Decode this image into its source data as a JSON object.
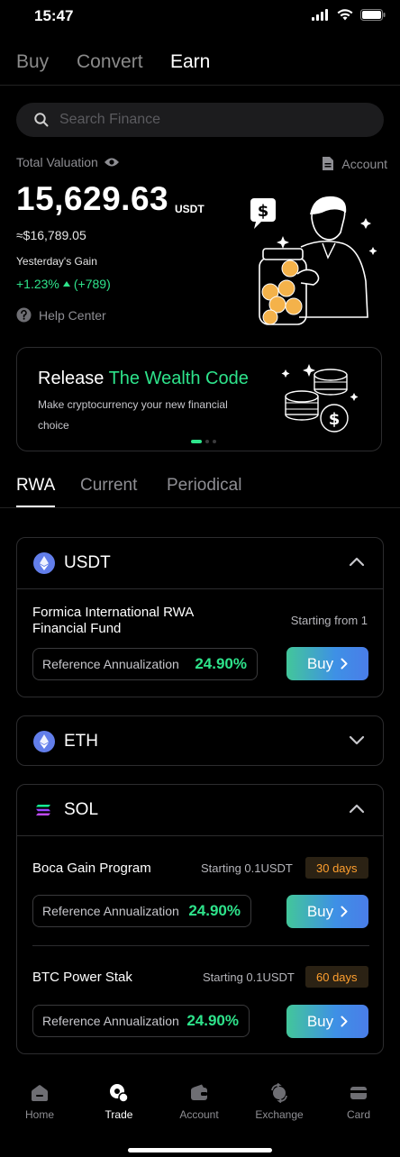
{
  "status": {
    "time": "15:47"
  },
  "top_tabs": [
    {
      "label": "Buy"
    },
    {
      "label": "Convert"
    },
    {
      "label": "Earn"
    }
  ],
  "search": {
    "placeholder": "Search Finance"
  },
  "valuation": {
    "label": "Total Valuation",
    "account_label": "Account",
    "amount": "15,629.63",
    "unit": "USDT",
    "usd": "≈$16,789.05",
    "yesterday_label": "Yesterday's Gain",
    "gain": "+1.23%",
    "gain_abs": "(+789)"
  },
  "help": {
    "label": "Help Center"
  },
  "banner": {
    "title_plain": "Release ",
    "title_highlight": "The Wealth Code",
    "subtitle": "Make cryptocurrency your new financial choice"
  },
  "sub_tabs": [
    {
      "label": "RWA"
    },
    {
      "label": "Current"
    },
    {
      "label": "Periodical"
    }
  ],
  "groups": {
    "usdt": {
      "name": "USDT",
      "product": {
        "title": "Formica International RWA Financial Fund",
        "starting": "Starting from 1",
        "ref_label": "Reference Annualization",
        "rate": "24.90%",
        "buy": "Buy"
      }
    },
    "eth": {
      "name": "ETH"
    },
    "sol": {
      "name": "SOL",
      "products": [
        {
          "title": "Boca Gain Program",
          "starting": "Starting  0.1USDT",
          "days": "30 days",
          "ref_label": "Reference Annualization",
          "rate": "24.90%",
          "buy": "Buy"
        },
        {
          "title": "BTC Power Stak",
          "starting": "Starting  0.1USDT",
          "days": "60 days",
          "ref_label": "Reference Annualization",
          "rate": "24.90%",
          "buy": "Buy"
        }
      ]
    }
  },
  "nav": [
    {
      "label": "Home"
    },
    {
      "label": "Trade"
    },
    {
      "label": "Account"
    },
    {
      "label": "Exchange"
    },
    {
      "label": "Card"
    }
  ],
  "colors": {
    "accent": "#2ee38b",
    "badge_text": "#ff9f2e"
  }
}
